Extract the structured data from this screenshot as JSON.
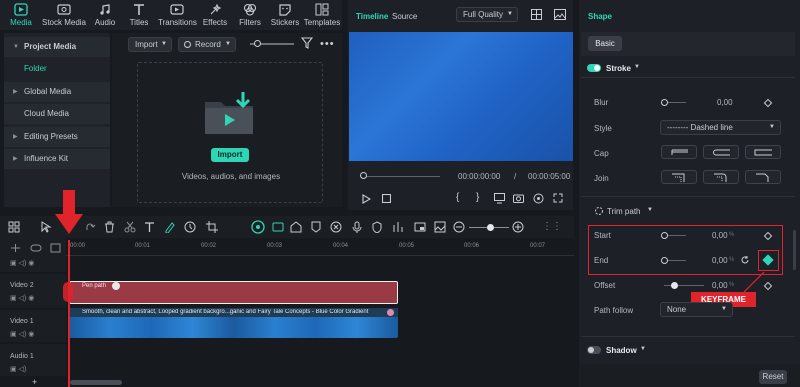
{
  "nav": {
    "items": [
      {
        "label": "Media",
        "icon": "media-icon",
        "active": true
      },
      {
        "label": "Stock Media",
        "icon": "stock-media-icon"
      },
      {
        "label": "Audio",
        "icon": "audio-icon"
      },
      {
        "label": "Titles",
        "icon": "titles-icon"
      },
      {
        "label": "Transitions",
        "icon": "transitions-icon"
      },
      {
        "label": "Effects",
        "icon": "effects-icon"
      },
      {
        "label": "Filters",
        "icon": "filters-icon"
      },
      {
        "label": "Stickers",
        "icon": "stickers-icon"
      },
      {
        "label": "Templates",
        "icon": "templates-icon"
      }
    ]
  },
  "sidebar": {
    "items": [
      {
        "label": "Project Media",
        "expandable": true
      },
      {
        "label": "Folder",
        "active": true
      },
      {
        "label": "Global Media",
        "expandable": true
      },
      {
        "label": "Cloud Media"
      },
      {
        "label": "Editing Presets",
        "expandable": true
      },
      {
        "label": "Influence Kit",
        "expandable": true
      }
    ]
  },
  "media": {
    "import_label": "Import",
    "record_label": "Record",
    "import_button": "Import",
    "hint": "Videos, audios, and images"
  },
  "preview": {
    "tab_timeline": "Timeline",
    "tab_source": "Source",
    "quality": "Full Quality",
    "current_time": "00:00:00:00",
    "separator": "/",
    "total_time": "00:00:05:00"
  },
  "panel": {
    "title": "Shape",
    "tab": "Basic",
    "stroke_label": "Stroke",
    "blur_label": "Blur",
    "blur_value": "0,00",
    "style_label": "Style",
    "style_value": "-------- Dashed line",
    "cap_label": "Cap",
    "join_label": "Join",
    "trim_label": "Trim path",
    "start_label": "Start",
    "start_value": "0,00",
    "start_unit": "%",
    "end_label": "End",
    "end_value": "0,00",
    "end_unit": "%",
    "offset_label": "Offset",
    "offset_value": "0,00",
    "offset_unit": "%",
    "keyframe_label": "KEYFRAME",
    "pathfollow_label": "Path follow",
    "pathfollow_value": "None",
    "shadow_label": "Shadow",
    "reset_label": "Reset",
    "accent": "#2fd6b5",
    "highlight": "#e0242b"
  },
  "timeline": {
    "ruler": [
      "00:00",
      "00:01",
      "00:02",
      "00:03",
      "00:04",
      "00:05",
      "00:06",
      "00:07"
    ],
    "tracks": [
      {
        "label": "Video 2"
      },
      {
        "label": "Video 1"
      },
      {
        "label": "Audio 1"
      }
    ],
    "clip_pen": "Pen path",
    "clip_video": "Smooth, clean and abstract, Looped gradient backgro...ganic and Fairy Tale Concepts - Blue Color Gradient"
  }
}
